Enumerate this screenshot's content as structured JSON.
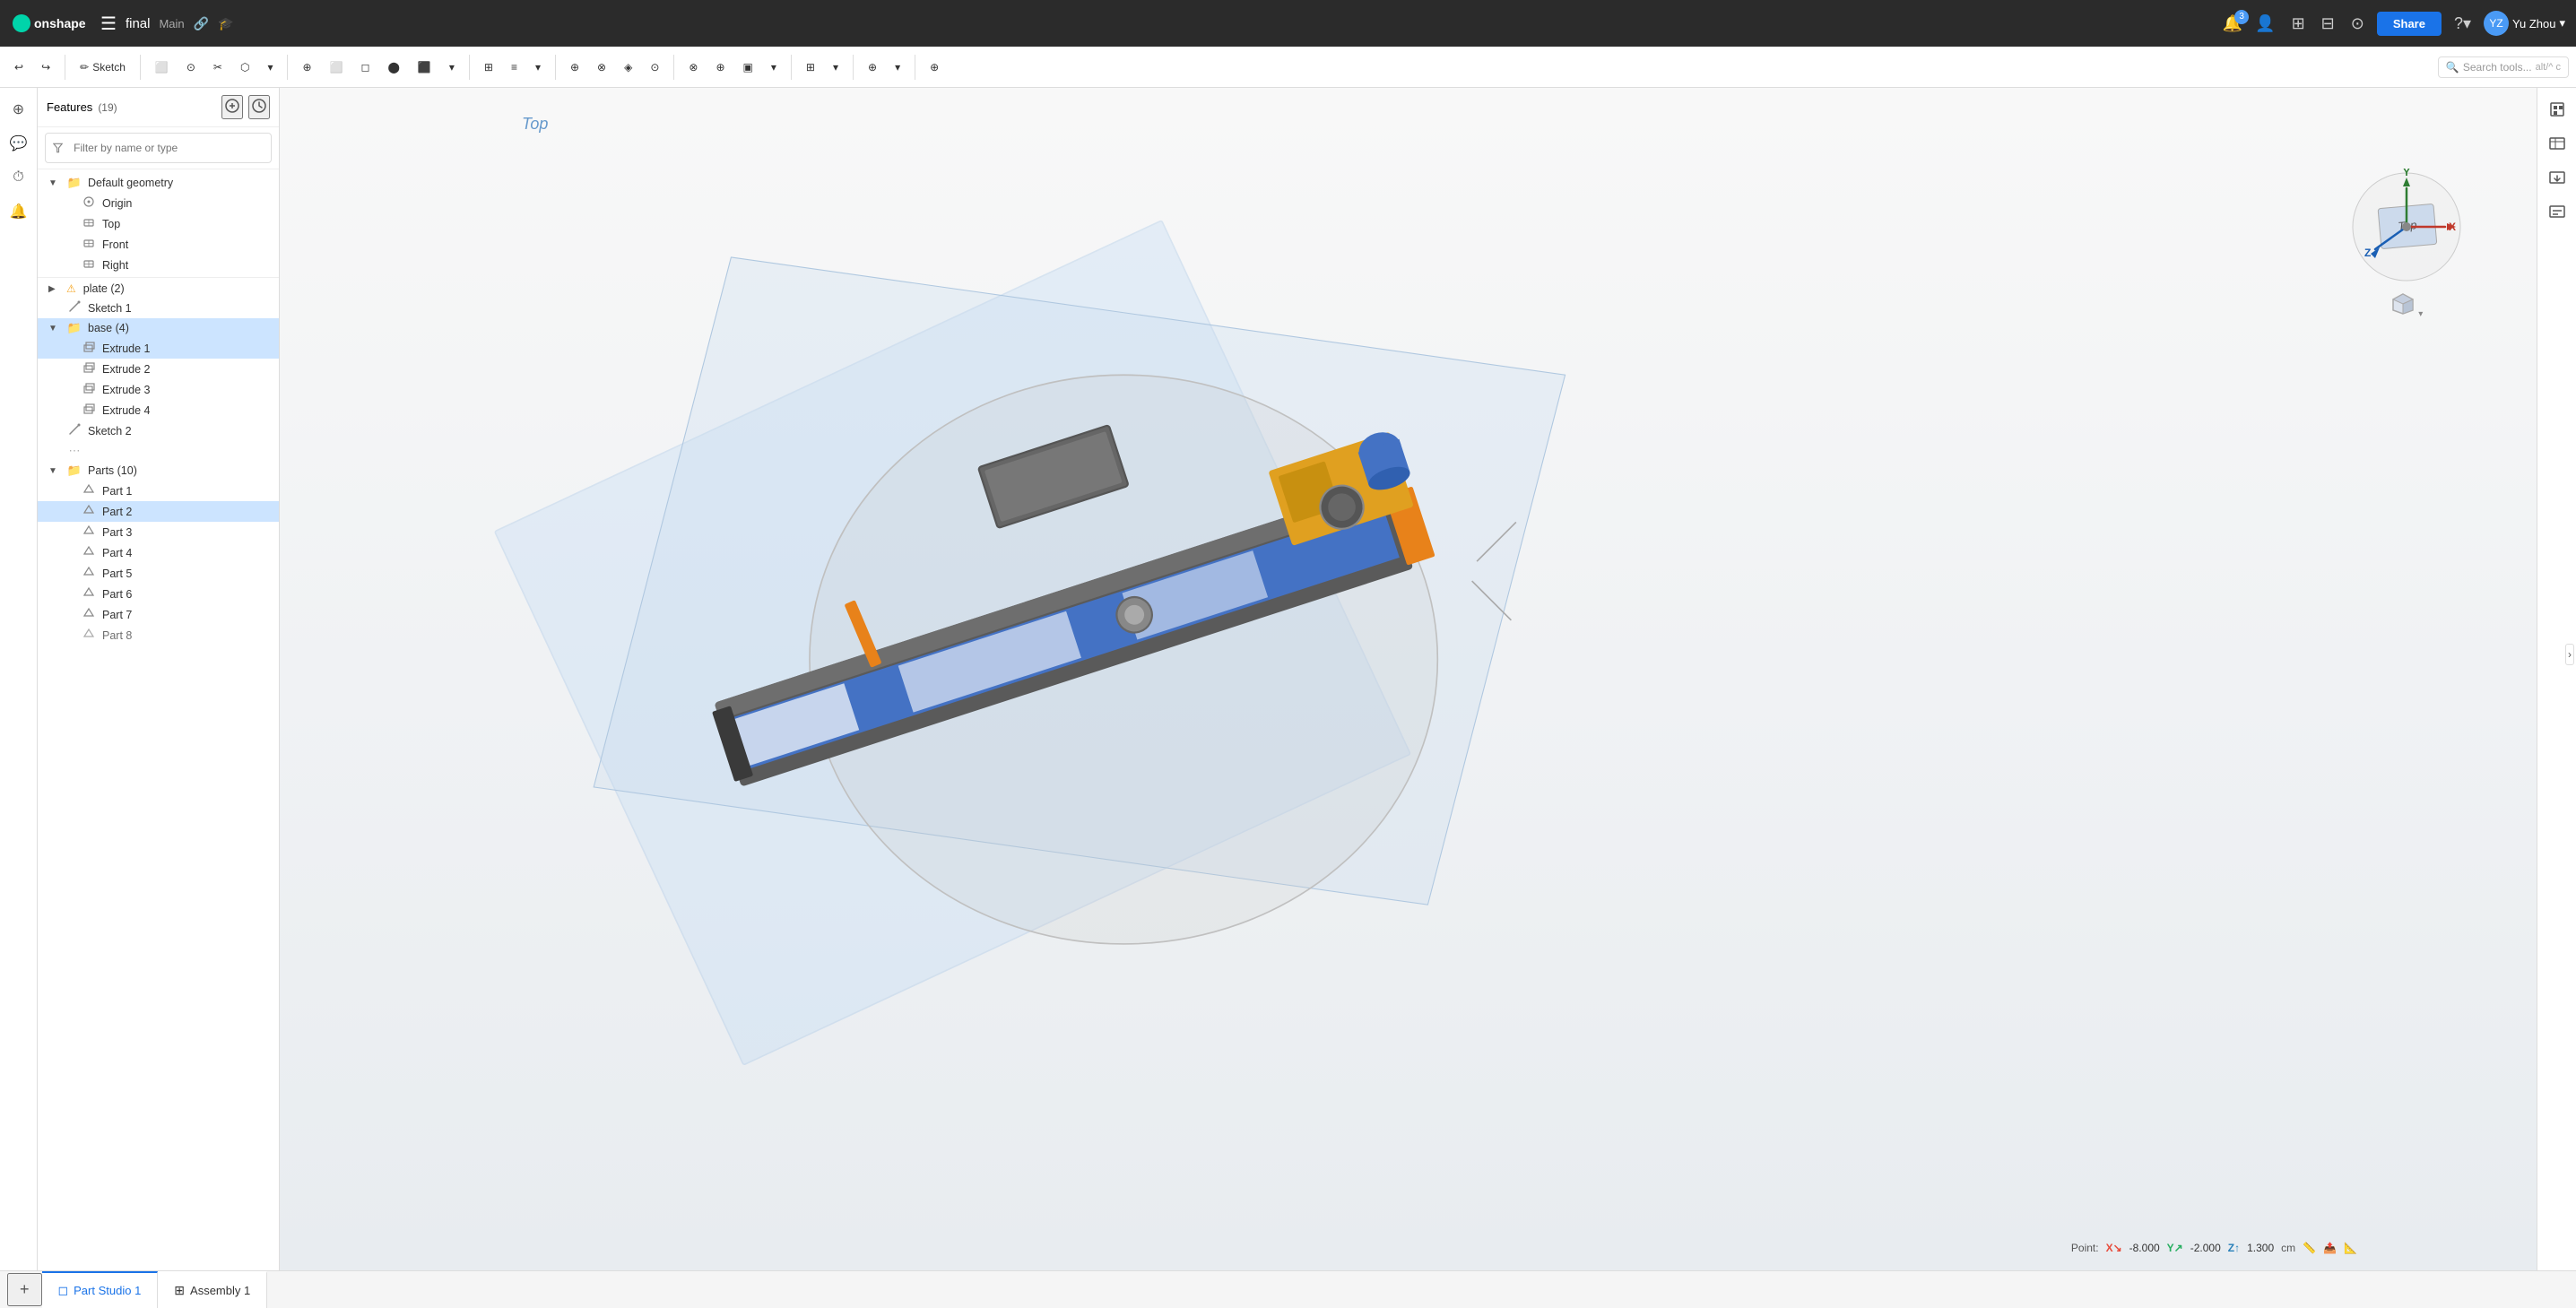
{
  "topbar": {
    "logo_text": "onshape",
    "hamburger_icon": "☰",
    "doc_title": "final",
    "branch": "Main",
    "link_icon": "🔗",
    "grad_icon": "🎓",
    "notifications_count": "3",
    "share_label": "Share",
    "help_icon": "?",
    "user_name": "Yu Zhou",
    "user_arrow": "▾",
    "icon_buttons": [
      "⊞",
      "⊟",
      "⊙",
      "≡"
    ]
  },
  "toolbar2": {
    "undo_icon": "↩",
    "redo_icon": "↪",
    "sketch_label": "Sketch",
    "search_placeholder": "Search tools...",
    "search_shortcut": "alt/^ c",
    "tools": [
      {
        "label": "",
        "icon": "⬜"
      },
      {
        "label": "",
        "icon": "⊙"
      },
      {
        "label": "",
        "icon": "✂"
      },
      {
        "label": "",
        "icon": "⬡"
      },
      {
        "label": "",
        "icon": "⊕"
      },
      {
        "label": "",
        "icon": "⬜"
      },
      {
        "label": "",
        "icon": "◻"
      },
      {
        "label": "",
        "icon": "⬤"
      },
      {
        "label": "",
        "icon": "⬛"
      },
      {
        "label": "",
        "icon": "⊞"
      },
      {
        "label": "",
        "icon": "≡"
      },
      {
        "label": "",
        "icon": "⊕"
      },
      {
        "label": "",
        "icon": "⊗"
      },
      {
        "label": "",
        "icon": "◈"
      },
      {
        "label": "",
        "icon": "⊙"
      },
      {
        "label": "",
        "icon": "⊗"
      },
      {
        "label": "",
        "icon": "⊕"
      },
      {
        "label": "",
        "icon": "▣"
      },
      {
        "label": "",
        "icon": "⊞"
      },
      {
        "label": "",
        "icon": "≡"
      },
      {
        "label": "",
        "icon": "⊕"
      },
      {
        "label": "",
        "icon": "⊙"
      },
      {
        "label": "",
        "icon": "⊞"
      },
      {
        "label": "",
        "icon": "≡"
      },
      {
        "label": "",
        "icon": "⊕"
      }
    ]
  },
  "features_panel": {
    "title": "Features",
    "count": "(19)",
    "filter_placeholder": "Filter by name or type",
    "tree": [
      {
        "id": "default-geom",
        "label": "Default geometry",
        "type": "section",
        "expanded": true,
        "indent": 0
      },
      {
        "id": "origin",
        "label": "Origin",
        "type": "origin",
        "indent": 1
      },
      {
        "id": "top",
        "label": "Top",
        "type": "plane",
        "indent": 1
      },
      {
        "id": "front",
        "label": "Front",
        "type": "plane",
        "indent": 1
      },
      {
        "id": "right",
        "label": "Right",
        "type": "plane",
        "indent": 1
      },
      {
        "id": "plate",
        "label": "plate (2)",
        "type": "warning",
        "indent": 0,
        "expanded": false
      },
      {
        "id": "sketch1",
        "label": "Sketch 1",
        "type": "sketch",
        "indent": 0
      },
      {
        "id": "base",
        "label": "base (4)",
        "type": "section",
        "expanded": true,
        "indent": 0,
        "selected": false
      },
      {
        "id": "extrude1",
        "label": "Extrude 1",
        "type": "extrude",
        "indent": 1,
        "selected": true
      },
      {
        "id": "extrude2",
        "label": "Extrude 2",
        "type": "extrude",
        "indent": 1
      },
      {
        "id": "extrude3",
        "label": "Extrude 3",
        "type": "extrude",
        "indent": 1
      },
      {
        "id": "extrude4",
        "label": "Extrude 4",
        "type": "extrude",
        "indent": 1
      },
      {
        "id": "sketch2",
        "label": "Sketch 2",
        "type": "sketch",
        "indent": 0
      },
      {
        "id": "parts",
        "label": "Parts (10)",
        "type": "section",
        "expanded": true,
        "indent": 0
      },
      {
        "id": "part1",
        "label": "Part 1",
        "type": "part",
        "indent": 1
      },
      {
        "id": "part2",
        "label": "Part 2",
        "type": "part",
        "indent": 1,
        "selected": true
      },
      {
        "id": "part3",
        "label": "Part 3",
        "type": "part",
        "indent": 1
      },
      {
        "id": "part4",
        "label": "Part 4",
        "type": "part",
        "indent": 1
      },
      {
        "id": "part5",
        "label": "Part 5",
        "type": "part",
        "indent": 1
      },
      {
        "id": "part6",
        "label": "Part 6",
        "type": "part",
        "indent": 1
      },
      {
        "id": "part7",
        "label": "Part 7",
        "type": "part",
        "indent": 1
      },
      {
        "id": "part8",
        "label": "Part 8",
        "type": "part",
        "indent": 1
      }
    ]
  },
  "viewport": {
    "label_top": "Top",
    "axis": {
      "x_label": "X",
      "y_label": "Y",
      "z_label": "Z"
    },
    "coord_label": "Point:",
    "coord_x_label": "X",
    "coord_x_val": "-8.000",
    "coord_y_label": "Y",
    "coord_y_val": "-2.000",
    "coord_z_label": "Z",
    "coord_z_val": "1.300",
    "coord_unit": "cm"
  },
  "bottom_tabs": {
    "add_icon": "+",
    "tabs": [
      {
        "id": "part-studio-1",
        "label": "Part Studio 1",
        "icon": "◻",
        "active": true
      },
      {
        "id": "assembly-1",
        "label": "Assembly 1",
        "icon": "⊞",
        "active": false
      }
    ]
  },
  "right_panel": {
    "icons": [
      "⊞",
      "⊟",
      "◻",
      "⊙"
    ]
  },
  "sidebar_icons": {
    "icons": [
      {
        "name": "add-part",
        "icon": "⊕"
      },
      {
        "name": "comment",
        "icon": "💬"
      },
      {
        "name": "history",
        "icon": "⏱"
      },
      {
        "name": "settings",
        "icon": "⚙"
      }
    ]
  }
}
